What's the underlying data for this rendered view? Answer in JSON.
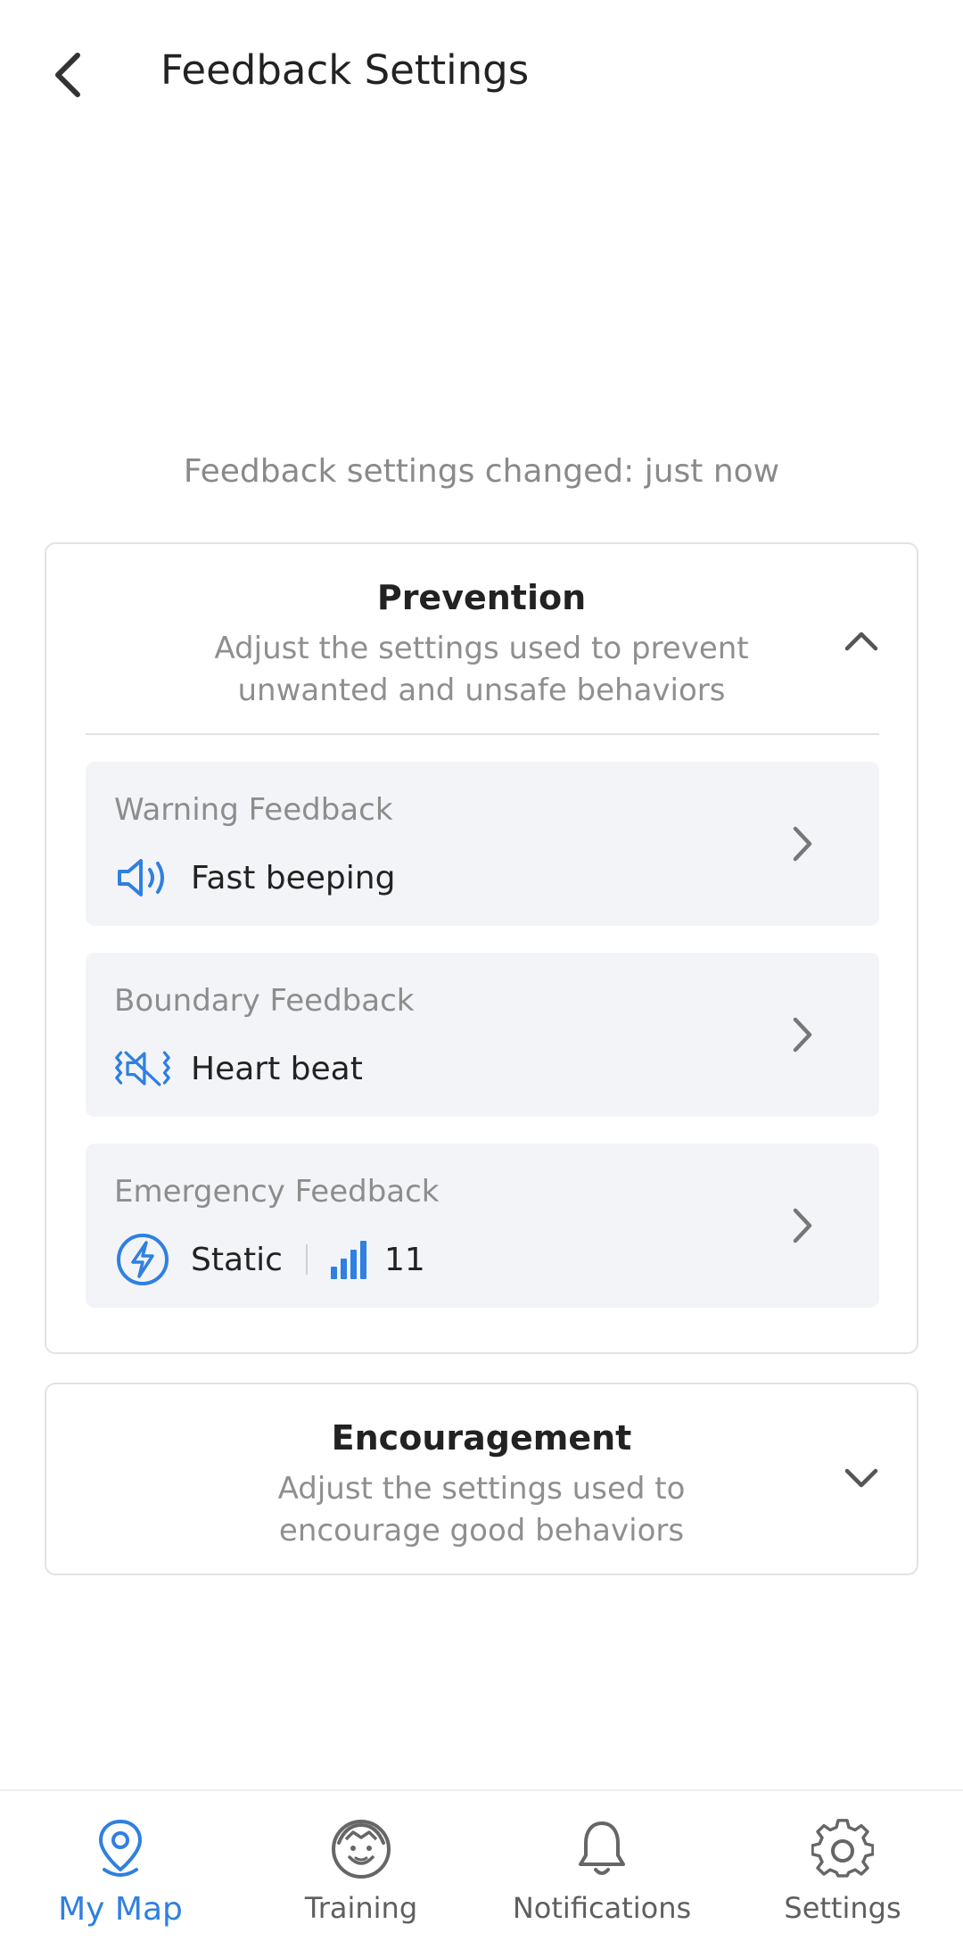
{
  "header": {
    "title": "Feedback Settings",
    "back_icon": "chevron-left-icon"
  },
  "status": {
    "changed_text": "Feedback settings changed: just now"
  },
  "prevention": {
    "title": "Prevention",
    "description": "Adjust the settings used to prevent unwanted and unsafe behaviors",
    "expanded": true,
    "items": [
      {
        "label": "Warning Feedback",
        "icon": "speaker-sound-icon",
        "value": "Fast beeping"
      },
      {
        "label": "Boundary Feedback",
        "icon": "vibrate-mute-icon",
        "value": "Heart beat"
      },
      {
        "label": "Emergency Feedback",
        "icon": "lightning-bolt-icon",
        "value": "Static",
        "level_icon": "signal-bars-icon",
        "level": "11"
      }
    ]
  },
  "encouragement": {
    "title": "Encouragement",
    "description": "Adjust the settings used to encourage good behaviors",
    "expanded": false
  },
  "nav": {
    "items": [
      {
        "label": "My Map",
        "icon": "map-pin-icon",
        "active": true
      },
      {
        "label": "Training",
        "icon": "trainer-avatar-icon",
        "active": false
      },
      {
        "label": "Notifications",
        "icon": "bell-icon",
        "active": false
      },
      {
        "label": "Settings",
        "icon": "gear-icon",
        "active": false
      }
    ]
  },
  "colors": {
    "accent": "#2f80e0",
    "card_border": "#e3e3e6",
    "item_background": "#f3f4f8",
    "muted_text": "#8d8d8d"
  }
}
